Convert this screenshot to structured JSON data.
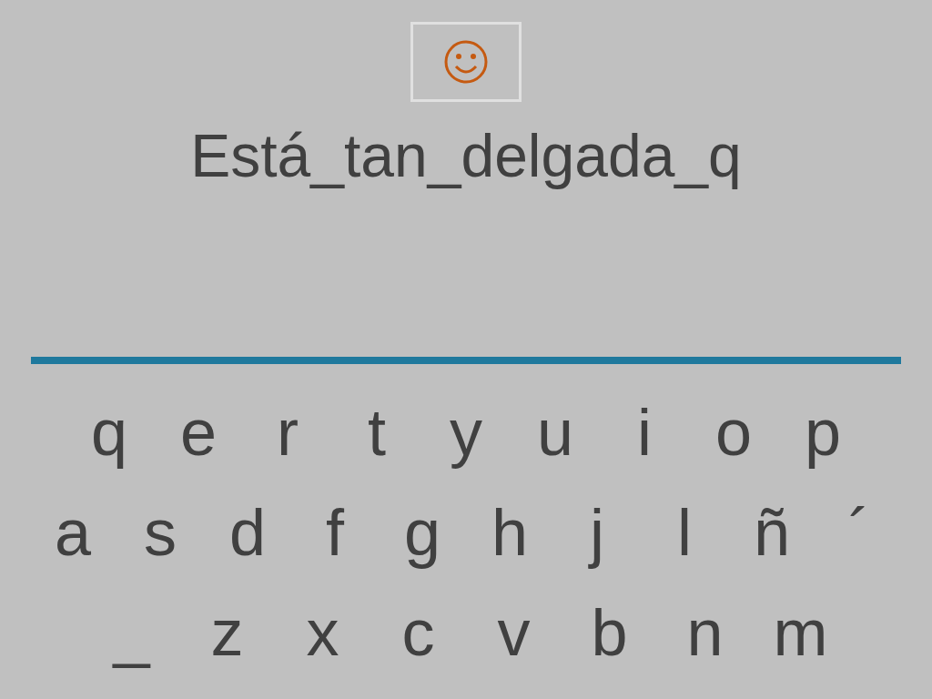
{
  "phrase": "Está_tan_delgada_q",
  "keyboard_rows": [
    [
      "q",
      "e",
      "r",
      "t",
      "y",
      "u",
      "i",
      "o",
      "p"
    ],
    [
      "a",
      "s",
      "d",
      "f",
      "g",
      "h",
      "j",
      "l",
      "ñ",
      "´"
    ],
    [
      "_",
      "z",
      "x",
      "c",
      "v",
      "b",
      "n",
      "m"
    ]
  ]
}
